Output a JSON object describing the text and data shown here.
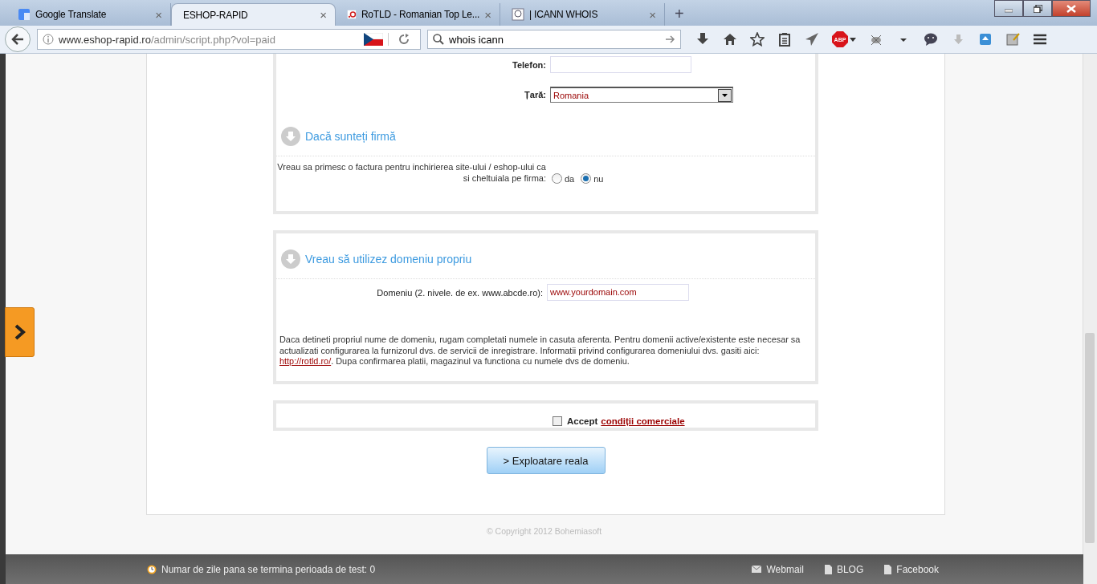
{
  "browser": {
    "tabs": [
      {
        "title": "Google Translate",
        "selected": false
      },
      {
        "title": "ESHOP-RAPID",
        "selected": true
      },
      {
        "title": "RoTLD - Romanian Top Le...",
        "selected": false
      },
      {
        "title": "| ICANN WHOIS",
        "selected": false
      }
    ],
    "new_tab": "+",
    "close": "×",
    "address": {
      "domain": "www.eshop-rapid.ro",
      "path": "/admin/script.php?vol=paid"
    },
    "search": {
      "value": "whois icann"
    },
    "adblock_label": "ABP"
  },
  "form": {
    "phone": {
      "label": "Telefon:"
    },
    "country": {
      "label": "Țară:",
      "value": "Romania"
    },
    "company_section": {
      "title": "Dacă sunteți firmă",
      "question": "Vreau sa primesc o factura pentru inchirierea site-ului / eshop-ului ca si cheltuiala pe firma:",
      "options": [
        {
          "label": "da",
          "selected": false
        },
        {
          "label": "nu",
          "selected": true
        }
      ]
    },
    "domain_section": {
      "title": "Vreau să utilizez domeniu propriu",
      "label": "Domeniu (2. nivele. de ex. www.abcde.ro):",
      "value": "www.yourdomain.com",
      "note_before": "Daca detineti propriul nume de domeniu, rugam completati numele in casuta aferenta. Pentru domenii active/existente este necesar sa actualizati configurarea la furnizorul dvs. de servicii de inregistrare. Informatii privind configurarea domeniului dvs. gasiti aici:",
      "note_link": "http://rotld.ro/",
      "note_after": ". Dupa confirmarea platii, magazinul va functiona cu numele dvs de domeniu."
    },
    "accept": {
      "label": "Accept",
      "link": "condiții comerciale",
      "checked": false
    },
    "submit": "> Exploatare reala"
  },
  "copyright": "© Copyright 2012 Bohemiasoft",
  "footer": {
    "trial": "Numar de zile pana se termina perioada de test: 0",
    "links": [
      "Webmail",
      "BLOG",
      "Facebook"
    ]
  }
}
